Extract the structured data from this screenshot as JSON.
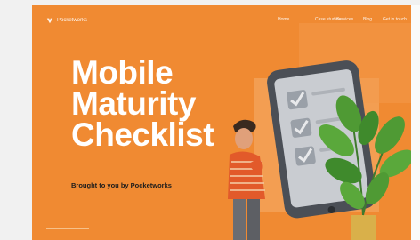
{
  "brand": {
    "name": "Pocketworks"
  },
  "nav": {
    "items": [
      {
        "label": "Home"
      },
      {
        "label": "Case studies"
      },
      {
        "label": "Services"
      },
      {
        "label": "Blog"
      },
      {
        "label": "Get in touch"
      }
    ]
  },
  "hero": {
    "title_lines": [
      "Mobile",
      "Maturity",
      "Checklist"
    ],
    "byline": "Brought to you by Pocketworks"
  },
  "colors": {
    "background": "#f08a32",
    "text": "#ffffff",
    "byline": "#1c1c1c"
  },
  "icons": [
    "pocketworks-logo-icon",
    "phone-illustration",
    "checkmark-icon",
    "plant-illustration",
    "person-illustration"
  ]
}
